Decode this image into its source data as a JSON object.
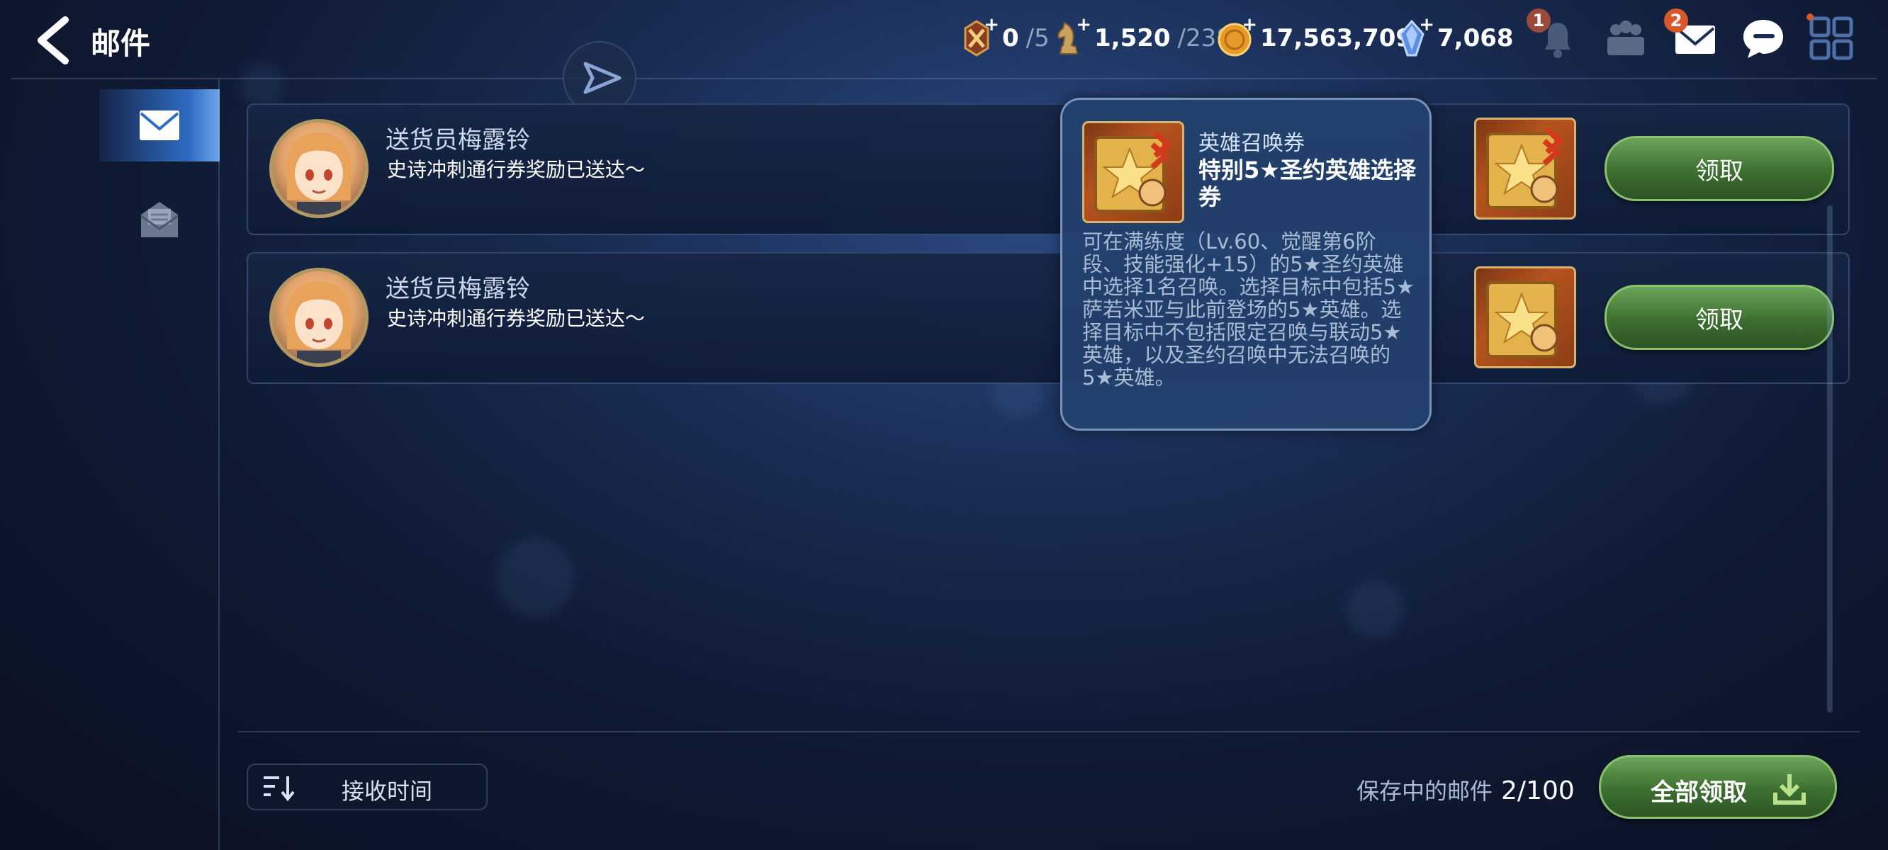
{
  "header": {
    "title": "邮件",
    "resources": [
      {
        "icon": "stamina-sword-icon",
        "value": "0",
        "max": "/5"
      },
      {
        "icon": "knight-piece-icon",
        "value": "1,520",
        "max": "/238"
      },
      {
        "icon": "gold-coin-icon",
        "value": "17,563,709",
        "max": ""
      },
      {
        "icon": "crystal-gem-icon",
        "value": "7,068",
        "max": ""
      }
    ],
    "notification_badge": "1",
    "mail_badge": "2"
  },
  "mails": [
    {
      "sender": "送货员梅露铃",
      "message": "史诗冲刺通行券奖励已送达～",
      "claim_label": "领取"
    },
    {
      "sender": "送货员梅露铃",
      "message": "史诗冲刺通行券奖励已送达～",
      "claim_label": "领取"
    }
  ],
  "tooltip": {
    "category": "英雄召唤券",
    "name": "特别5★圣约英雄选择券",
    "description": "可在满练度（Lv.60、觉醒第6阶段、技能强化+15）的5★圣约英雄中选择1名召唤。选择目标中包括5★萨若米亚与此前登场的5★英雄。选择目标中不包括限定召唤与联动5★英雄，以及圣约召唤中无法召唤的5★英雄。"
  },
  "footer": {
    "sort_label": "接收时间",
    "storage_label": "保存中的邮件",
    "storage_count": "2/100",
    "claim_all_label": "全部领取"
  },
  "colors": {
    "claim_green": "#3c6f2f",
    "active_tab_blue": "#2f6cc4",
    "badge_orange": "#d9572b"
  }
}
